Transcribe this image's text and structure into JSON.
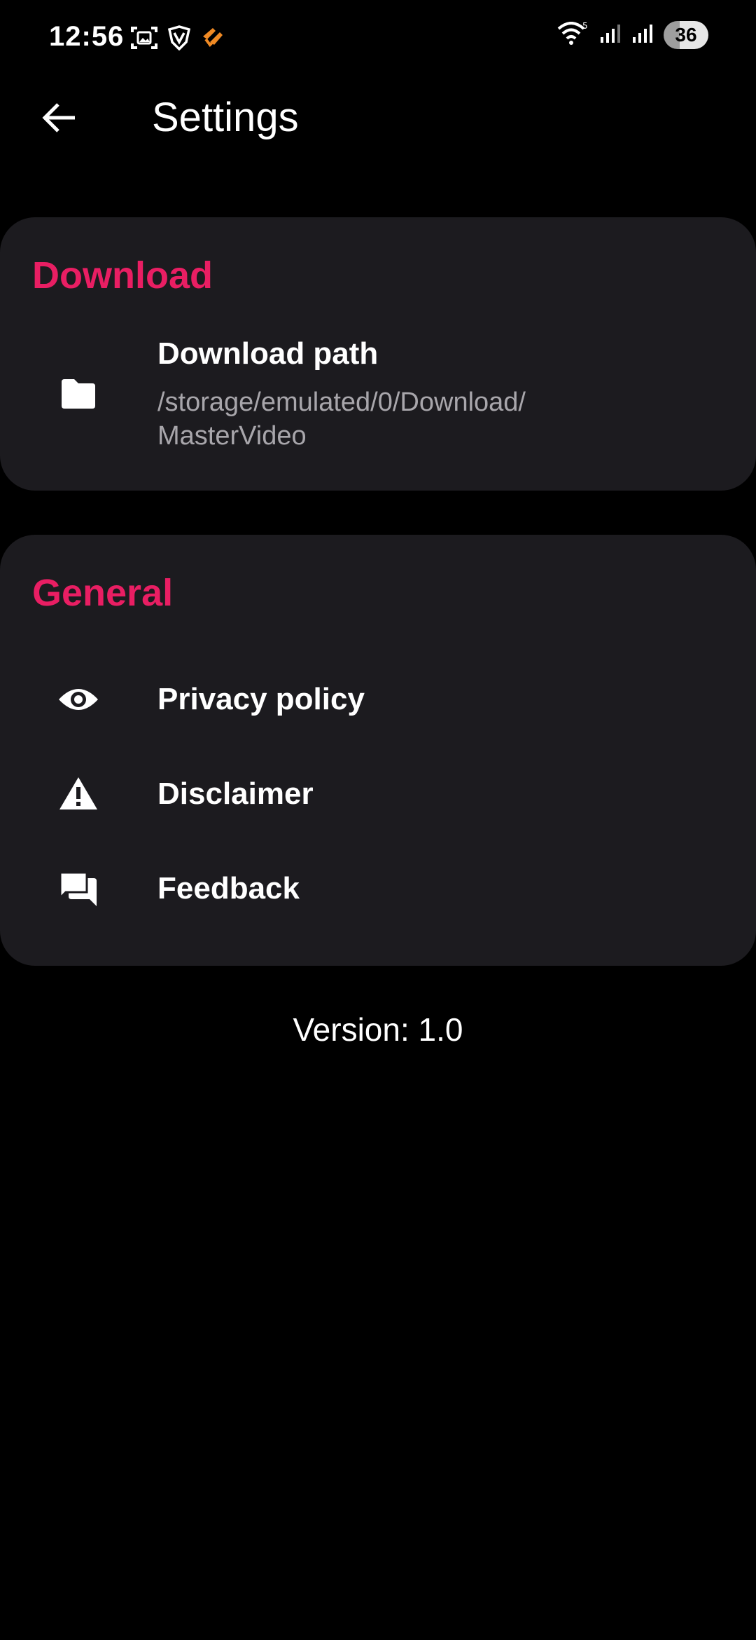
{
  "status_bar": {
    "time": "12:56",
    "battery_level": "36",
    "icons_left": [
      "screenshot-icon",
      "vpn-shield-icon",
      "app-notification-icon"
    ],
    "icons_right": [
      "wifi-icon",
      "cellular-signal-icon",
      "cellular-signal-icon",
      "battery-icon"
    ]
  },
  "app_bar": {
    "back_icon": "arrow-left-icon",
    "title": "Settings"
  },
  "sections": {
    "download": {
      "header": "Download",
      "items": [
        {
          "icon": "folder-icon",
          "title": "Download path",
          "subtitle": "/storage/emulated/0/Download/\nMasterVideo"
        }
      ]
    },
    "general": {
      "header": "General",
      "items": [
        {
          "icon": "eye-icon",
          "title": "Privacy policy"
        },
        {
          "icon": "warning-icon",
          "title": "Disclaimer"
        },
        {
          "icon": "feedback-icon",
          "title": "Feedback"
        }
      ]
    }
  },
  "footer": {
    "version": "Version: 1.0"
  },
  "colors": {
    "background": "#000000",
    "card": "#1c1b1f",
    "accent": "#e91e63",
    "subtitle": "#a8a6ab"
  }
}
